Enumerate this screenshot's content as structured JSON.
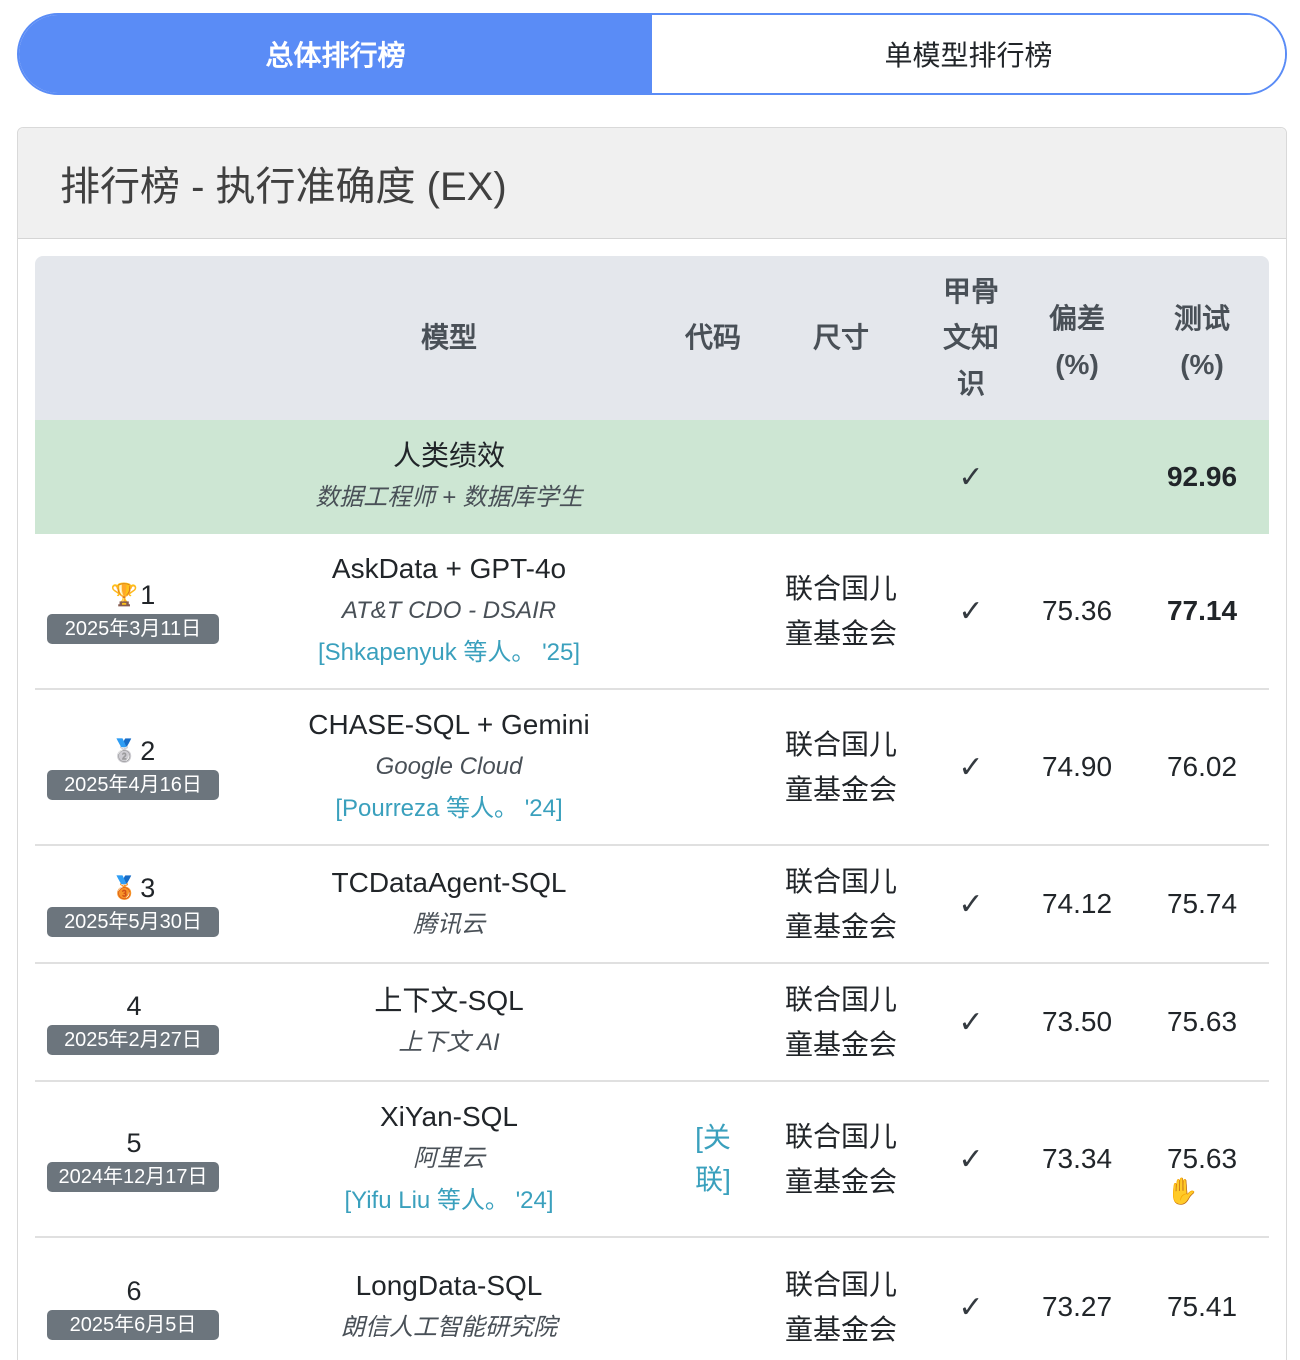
{
  "tabs": [
    {
      "label": "总体排行榜",
      "active": true
    },
    {
      "label": "单模型排行榜",
      "active": false
    }
  ],
  "card": {
    "title": "排行榜 - 执行准确度 (EX)"
  },
  "columns": {
    "model": "模型",
    "code": "代码",
    "size": "尺寸",
    "oracle": "甲骨\n文知\n识",
    "dev": "偏差\n(%)",
    "test": "测试\n(%)"
  },
  "human": {
    "title": "人类绩效",
    "subtitle": "数据工程师 + 数据库学生",
    "oracle": "✓",
    "test": "92.96"
  },
  "rows": [
    {
      "medal": "🏆",
      "rank": "1",
      "date": "2025年3月11日",
      "model": "AskData + GPT-4o",
      "org": "AT&T CDO - DSAIR",
      "cite": "[Shkapenyuk 等人。 '25]",
      "code": "",
      "size": "联合国儿\n童基金会",
      "oracle": "✓",
      "dev": "75.36",
      "test": "77.14",
      "test_bold": true
    },
    {
      "medal": "🥈",
      "rank": "2",
      "date": "2025年4月16日",
      "model": "CHASE-SQL + Gemini",
      "org": "Google Cloud",
      "cite": "[Pourreza 等人。 '24]",
      "code": "",
      "size": "联合国儿\n童基金会",
      "oracle": "✓",
      "dev": "74.90",
      "test": "76.02",
      "test_bold": false
    },
    {
      "medal": "🥉",
      "rank": "3",
      "date": "2025年5月30日",
      "model": "TCDataAgent-SQL",
      "org": "腾讯云",
      "cite": "",
      "code": "",
      "size": "联合国儿\n童基金会",
      "oracle": "✓",
      "dev": "74.12",
      "test": "75.74",
      "test_bold": false
    },
    {
      "medal": "",
      "rank": "4",
      "date": "2025年2月27日",
      "model": "上下文-SQL",
      "org": "上下文 AI",
      "cite": "",
      "code": "",
      "size": "联合国儿\n童基金会",
      "oracle": "✓",
      "dev": "73.50",
      "test": "75.63",
      "test_bold": false
    },
    {
      "medal": "",
      "rank": "5",
      "date": "2024年12月17日",
      "model": "XiYan-SQL",
      "org": "阿里云",
      "cite": "[Yifu Liu 等人。 '24]",
      "code": "[关\n联]",
      "size": "联合国儿\n童基金会",
      "oracle": "✓",
      "dev": "73.34",
      "test": "75.63",
      "test_bold": false
    },
    {
      "medal": "",
      "rank": "6",
      "date": "2025年6月5日",
      "model": "LongData-SQL",
      "org": "朗信人工智能研究院",
      "cite": "",
      "code": "",
      "size": "联合国儿\n童基金会",
      "oracle": "✓",
      "dev": "73.27",
      "test": "75.41",
      "test_bold": false
    }
  ]
}
